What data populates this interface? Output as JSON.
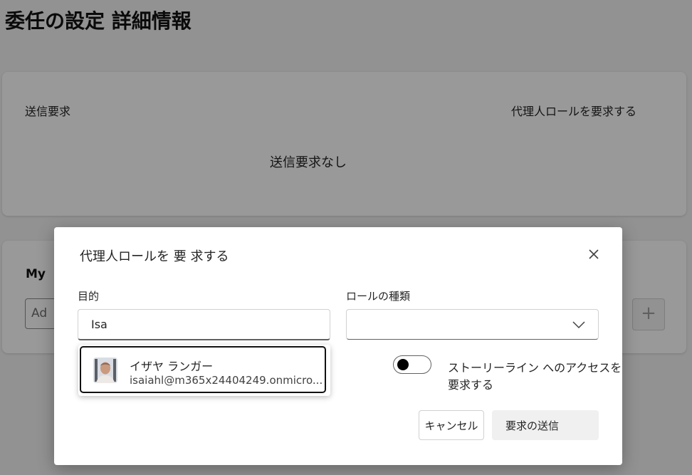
{
  "page": {
    "title": "委任の設定 詳細情報"
  },
  "sent_requests": {
    "heading": "送信要求",
    "request_link": "代理人ロールを要求する",
    "empty_text": "送信要求なし"
  },
  "my_section": {
    "title": "My",
    "input_placeholder": "Ad",
    "add_button": "+"
  },
  "dialog": {
    "title": "代理人ロールを 要 求する",
    "purpose_label": "目的",
    "purpose_value": "Isa",
    "role_label": "ロールの種類",
    "role_value": "",
    "toggle_label": "ストーリーライン へのアクセスを要求する",
    "toggle_on": false,
    "cancel_label": "キャンセル",
    "send_label": "要求の送信"
  },
  "suggestion": {
    "name": "イザヤ ランガー",
    "email": "isaiahl@m365x24404249.onmicro..."
  },
  "colors": {
    "overlay": "#000000",
    "primary_text": "#242424",
    "border": "#d1d1d1"
  }
}
